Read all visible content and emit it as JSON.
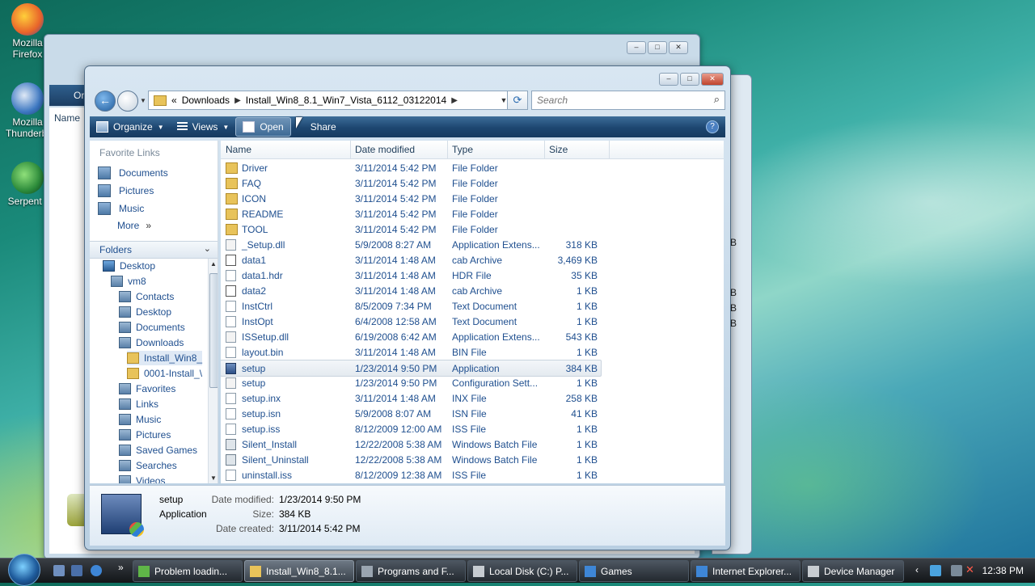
{
  "desktop": {
    "icons": [
      {
        "label_line1": "Mozilla",
        "label_line2": "Firefox"
      },
      {
        "label_line1": "Mozilla",
        "label_line2": "Thunderbi"
      },
      {
        "label_line1": "Serpent I",
        "label_line2": ""
      }
    ]
  },
  "back_window": {
    "side_labels": [
      "Organ",
      "Name"
    ],
    "right_sizes": [
      "B",
      "B",
      "B",
      "B"
    ]
  },
  "window": {
    "address": {
      "chevron": "«",
      "segments": [
        "Downloads",
        "Install_Win8_8.1_Win7_Vista_6112_03122014"
      ]
    },
    "search_placeholder": "Search",
    "toolbar": {
      "organize": "Organize",
      "views": "Views",
      "open": "Open",
      "share": "Share",
      "help": "?"
    },
    "favorite_links": {
      "title": "Favorite Links",
      "items": [
        "Documents",
        "Pictures",
        "Music",
        "More"
      ]
    },
    "folders_title": "Folders",
    "tree": [
      {
        "label": "Desktop",
        "indent": 0,
        "icon": "desk"
      },
      {
        "label": "vm8",
        "indent": 1,
        "icon": "sys"
      },
      {
        "label": "Contacts",
        "indent": 2,
        "icon": "sys"
      },
      {
        "label": "Desktop",
        "indent": 2,
        "icon": "sys"
      },
      {
        "label": "Documents",
        "indent": 2,
        "icon": "sys"
      },
      {
        "label": "Downloads",
        "indent": 2,
        "icon": "sys"
      },
      {
        "label": "Install_Win8_",
        "indent": 3,
        "icon": "fold",
        "selected": true
      },
      {
        "label": "0001-Install_\\",
        "indent": 3,
        "icon": "fold"
      },
      {
        "label": "Favorites",
        "indent": 2,
        "icon": "sys"
      },
      {
        "label": "Links",
        "indent": 2,
        "icon": "sys"
      },
      {
        "label": "Music",
        "indent": 2,
        "icon": "sys"
      },
      {
        "label": "Pictures",
        "indent": 2,
        "icon": "sys"
      },
      {
        "label": "Saved Games",
        "indent": 2,
        "icon": "sys"
      },
      {
        "label": "Searches",
        "indent": 2,
        "icon": "sys"
      },
      {
        "label": "Videos",
        "indent": 2,
        "icon": "sys"
      }
    ],
    "columns": [
      "Name",
      "Date modified",
      "Type",
      "Size"
    ],
    "files": [
      {
        "name": "Driver",
        "date": "3/11/2014 5:42 PM",
        "type": "File Folder",
        "size": "",
        "icon": "fold"
      },
      {
        "name": "FAQ",
        "date": "3/11/2014 5:42 PM",
        "type": "File Folder",
        "size": "",
        "icon": "fold"
      },
      {
        "name": "ICON",
        "date": "3/11/2014 5:42 PM",
        "type": "File Folder",
        "size": "",
        "icon": "fold"
      },
      {
        "name": "README",
        "date": "3/11/2014 5:42 PM",
        "type": "File Folder",
        "size": "",
        "icon": "fold"
      },
      {
        "name": "TOOL",
        "date": "3/11/2014 5:42 PM",
        "type": "File Folder",
        "size": "",
        "icon": "fold"
      },
      {
        "name": "_Setup.dll",
        "date": "5/9/2008 8:27 AM",
        "type": "Application Extens...",
        "size": "318 KB",
        "icon": "cfg"
      },
      {
        "name": "data1",
        "date": "3/11/2014 1:48 AM",
        "type": "cab Archive",
        "size": "3,469 KB",
        "icon": "cab"
      },
      {
        "name": "data1.hdr",
        "date": "3/11/2014 1:48 AM",
        "type": "HDR File",
        "size": "35 KB",
        "icon": "doc"
      },
      {
        "name": "data2",
        "date": "3/11/2014 1:48 AM",
        "type": "cab Archive",
        "size": "1 KB",
        "icon": "cab"
      },
      {
        "name": "InstCtrl",
        "date": "8/5/2009 7:34 PM",
        "type": "Text Document",
        "size": "1 KB",
        "icon": "doc"
      },
      {
        "name": "InstOpt",
        "date": "6/4/2008 12:58 AM",
        "type": "Text Document",
        "size": "1 KB",
        "icon": "doc"
      },
      {
        "name": "ISSetup.dll",
        "date": "6/19/2008 6:42 AM",
        "type": "Application Extens...",
        "size": "543 KB",
        "icon": "cfg"
      },
      {
        "name": "layout.bin",
        "date": "3/11/2014 1:48 AM",
        "type": "BIN File",
        "size": "1 KB",
        "icon": "doc"
      },
      {
        "name": "setup",
        "date": "1/23/2014 9:50 PM",
        "type": "Application",
        "size": "384 KB",
        "icon": "app",
        "selected": true
      },
      {
        "name": "setup",
        "date": "1/23/2014 9:50 PM",
        "type": "Configuration Sett...",
        "size": "1 KB",
        "icon": "cfg"
      },
      {
        "name": "setup.inx",
        "date": "3/11/2014 1:48 AM",
        "type": "INX File",
        "size": "258 KB",
        "icon": "doc"
      },
      {
        "name": "setup.isn",
        "date": "5/9/2008 8:07 AM",
        "type": "ISN File",
        "size": "41 KB",
        "icon": "doc"
      },
      {
        "name": "setup.iss",
        "date": "8/12/2009 12:00 AM",
        "type": "ISS File",
        "size": "1 KB",
        "icon": "doc"
      },
      {
        "name": "Silent_Install",
        "date": "12/22/2008 5:38 AM",
        "type": "Windows Batch File",
        "size": "1 KB",
        "icon": "bat"
      },
      {
        "name": "Silent_Uninstall",
        "date": "12/22/2008 5:38 AM",
        "type": "Windows Batch File",
        "size": "1 KB",
        "icon": "bat"
      },
      {
        "name": "uninstall.iss",
        "date": "8/12/2009 12:38 AM",
        "type": "ISS File",
        "size": "1 KB",
        "icon": "doc"
      }
    ],
    "details": {
      "name": "setup",
      "type": "Application",
      "date_modified_label": "Date modified:",
      "date_modified": "1/23/2014 9:50 PM",
      "size_label": "Size:",
      "size": "384 KB",
      "date_created_label": "Date created:",
      "date_created": "3/11/2014 5:42 PM"
    }
  },
  "taskbar": {
    "quicklaunch_more": "»",
    "buttons": [
      {
        "label": "Problem loadin...",
        "icon_color": "#5fb548"
      },
      {
        "label": "Install_Win8_8.1...",
        "icon_color": "#e8c35a",
        "active": true
      },
      {
        "label": "Programs and F...",
        "icon_color": "#9aa5b0"
      },
      {
        "label": "Local Disk (C:) P...",
        "icon_color": "#c7ccd1"
      },
      {
        "label": "Games",
        "icon_color": "#3e86d6"
      },
      {
        "label": "Internet Explorer...",
        "icon_color": "#3e86d6"
      },
      {
        "label": "Device Manager",
        "icon_color": "#c7ccd1"
      }
    ],
    "clock": "12:38 PM"
  }
}
